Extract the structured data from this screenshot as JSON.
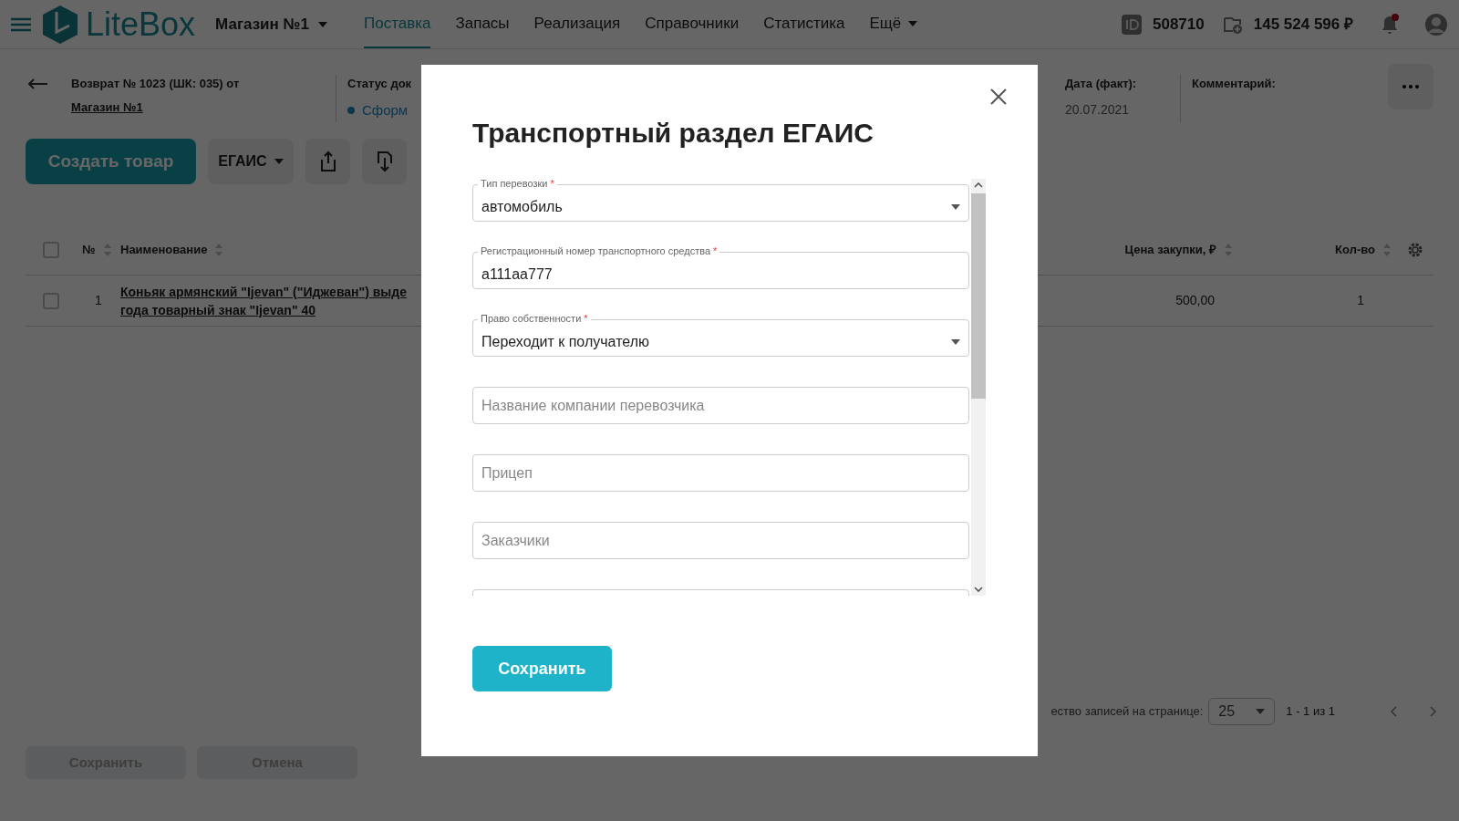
{
  "header": {
    "logo": "LiteBox",
    "store": "Магазин №1",
    "nav": [
      {
        "label": "Поставка",
        "selected": true
      },
      {
        "label": "Запасы",
        "selected": false
      },
      {
        "label": "Реализация",
        "selected": false
      },
      {
        "label": "Справочники",
        "selected": false
      },
      {
        "label": "Статистика",
        "selected": false
      },
      {
        "label": "Ещё",
        "selected": false,
        "dropdown": true
      }
    ],
    "account_id": "508710",
    "balance": "145 524 596 ₽",
    "notification_dot": true
  },
  "document": {
    "title": "Возврат № 1023 (ШК: 035) от",
    "store_link": "Магазин №1",
    "status_label": "Статус док",
    "status": "Сформ",
    "date_label": "Дата (факт):",
    "date": "20.07.2021",
    "comment_label": "Комментарий:"
  },
  "toolbar": {
    "create_button": "Создать товар",
    "egais_button": "ЕГАИС"
  },
  "table": {
    "select_all_checked": false,
    "columns": [
      "№",
      "Наименование",
      "Цена закупки, ₽",
      "Кол-во"
    ],
    "rows": [
      {
        "checked": false,
        "number": "1",
        "name_lines": [
          "Коньяк армянский \"Ijevan\" (\"Иджеван\") выде",
          "года товарный знак \"Ijevan\" 40"
        ],
        "price": "500,00",
        "quantity": "1"
      }
    ]
  },
  "pagination": {
    "label": "ество записей на странице:",
    "page_size": "25",
    "range": "1 - 1 из 1"
  },
  "footer_buttons": [
    {
      "label": "Сохранить",
      "disabled": true
    },
    {
      "label": "Отмена",
      "disabled": true
    }
  ],
  "modal": {
    "title": "Транспортный раздел ЕГАИС",
    "fields": [
      {
        "kind": "select",
        "label": "Тип перевозки",
        "required_mark": "*",
        "value": "автомобиль"
      },
      {
        "kind": "input",
        "label": "Регистрационный номер транспортного средства",
        "required_mark": "*",
        "value": "а111аа777"
      },
      {
        "kind": "select",
        "label": "Право собственности",
        "required_mark": "*",
        "value": "Переходит к получателю"
      },
      {
        "kind": "input",
        "placeholder": "Название компании перевозчика"
      },
      {
        "kind": "input",
        "placeholder": "Прицеп"
      },
      {
        "kind": "input",
        "placeholder": "Заказчики"
      },
      {
        "kind": "input"
      }
    ],
    "save_button": "Сохранить"
  }
}
